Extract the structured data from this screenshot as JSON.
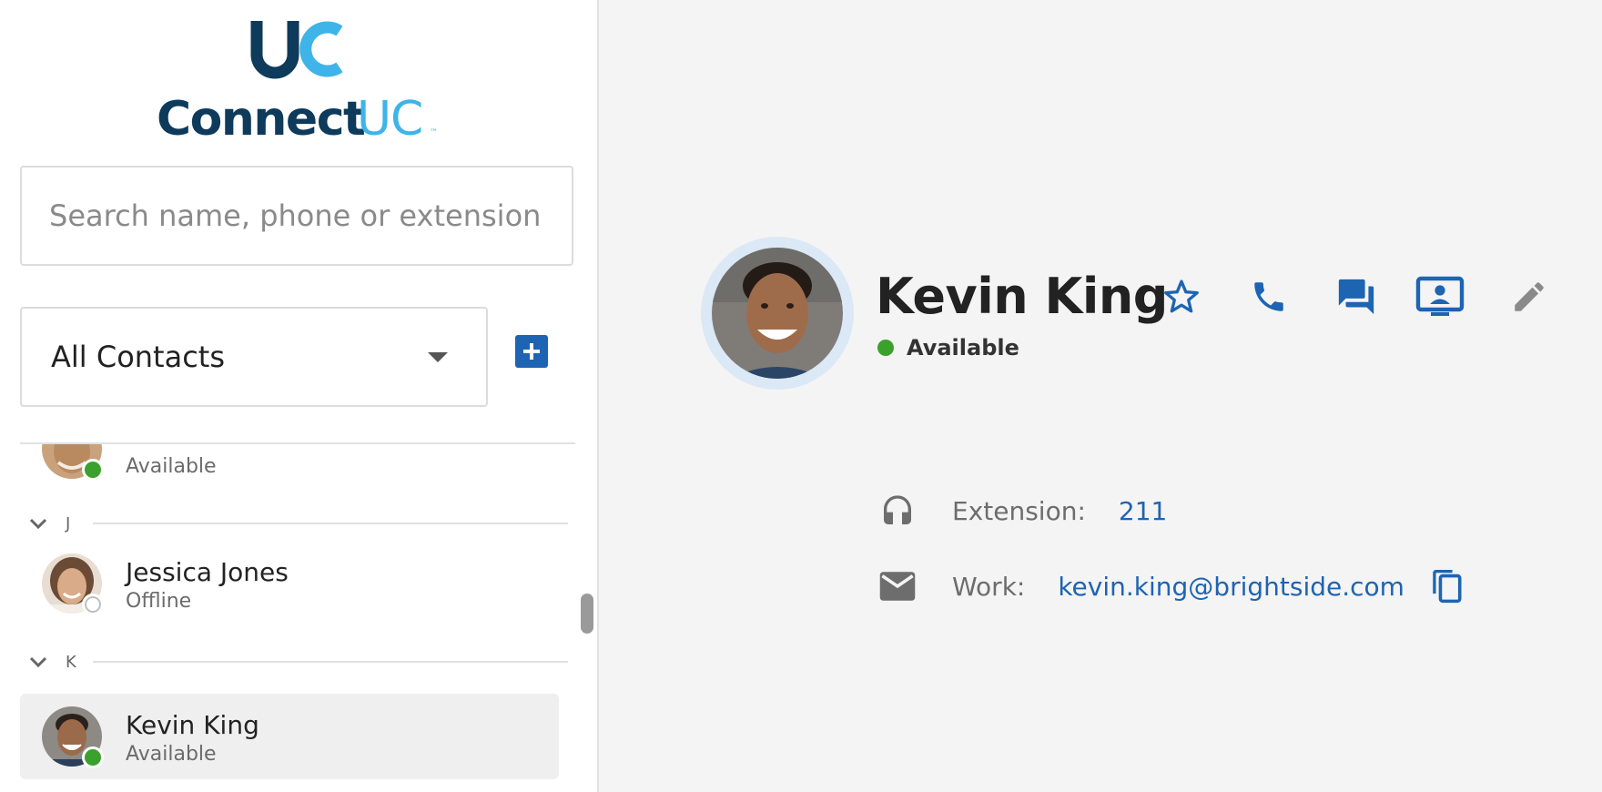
{
  "app": {
    "logo_mark": "UC",
    "logo_text_main": "Connect",
    "logo_text_accent": "UC",
    "logo_tm": "™"
  },
  "colors": {
    "brand_dark": "#0e3a5b",
    "brand_light": "#3eb4e8",
    "accent_blue": "#1d64b3",
    "available_green": "#3aa22c",
    "detail_bg": "#f4f4f4"
  },
  "search": {
    "placeholder": "Search name, phone or extension",
    "value": ""
  },
  "filter": {
    "selected": "All Contacts",
    "add_icon": "plus-icon"
  },
  "contacts": {
    "partial_row": {
      "status": "Available"
    },
    "groups": [
      {
        "letter": "J",
        "contacts": [
          {
            "name": "Jessica Jones",
            "status": "Offline"
          }
        ]
      },
      {
        "letter": "K",
        "contacts": [
          {
            "name": "Kevin King",
            "status": "Available",
            "selected": true
          }
        ]
      }
    ]
  },
  "detail": {
    "name": "Kevin King",
    "status": "Available",
    "actions": [
      {
        "name": "favorite",
        "icon": "star-outline-icon"
      },
      {
        "name": "call",
        "icon": "phone-icon"
      },
      {
        "name": "chat",
        "icon": "chat-icon"
      },
      {
        "name": "meeting",
        "icon": "screen-share-icon"
      },
      {
        "name": "edit",
        "icon": "pencil-icon"
      }
    ],
    "extension": {
      "icon": "headset-icon",
      "label": "Extension:",
      "value": "211"
    },
    "email": {
      "icon": "mail-icon",
      "label": "Work:",
      "value": "kevin.king@brightside.com",
      "copy_icon": "copy-icon"
    }
  }
}
